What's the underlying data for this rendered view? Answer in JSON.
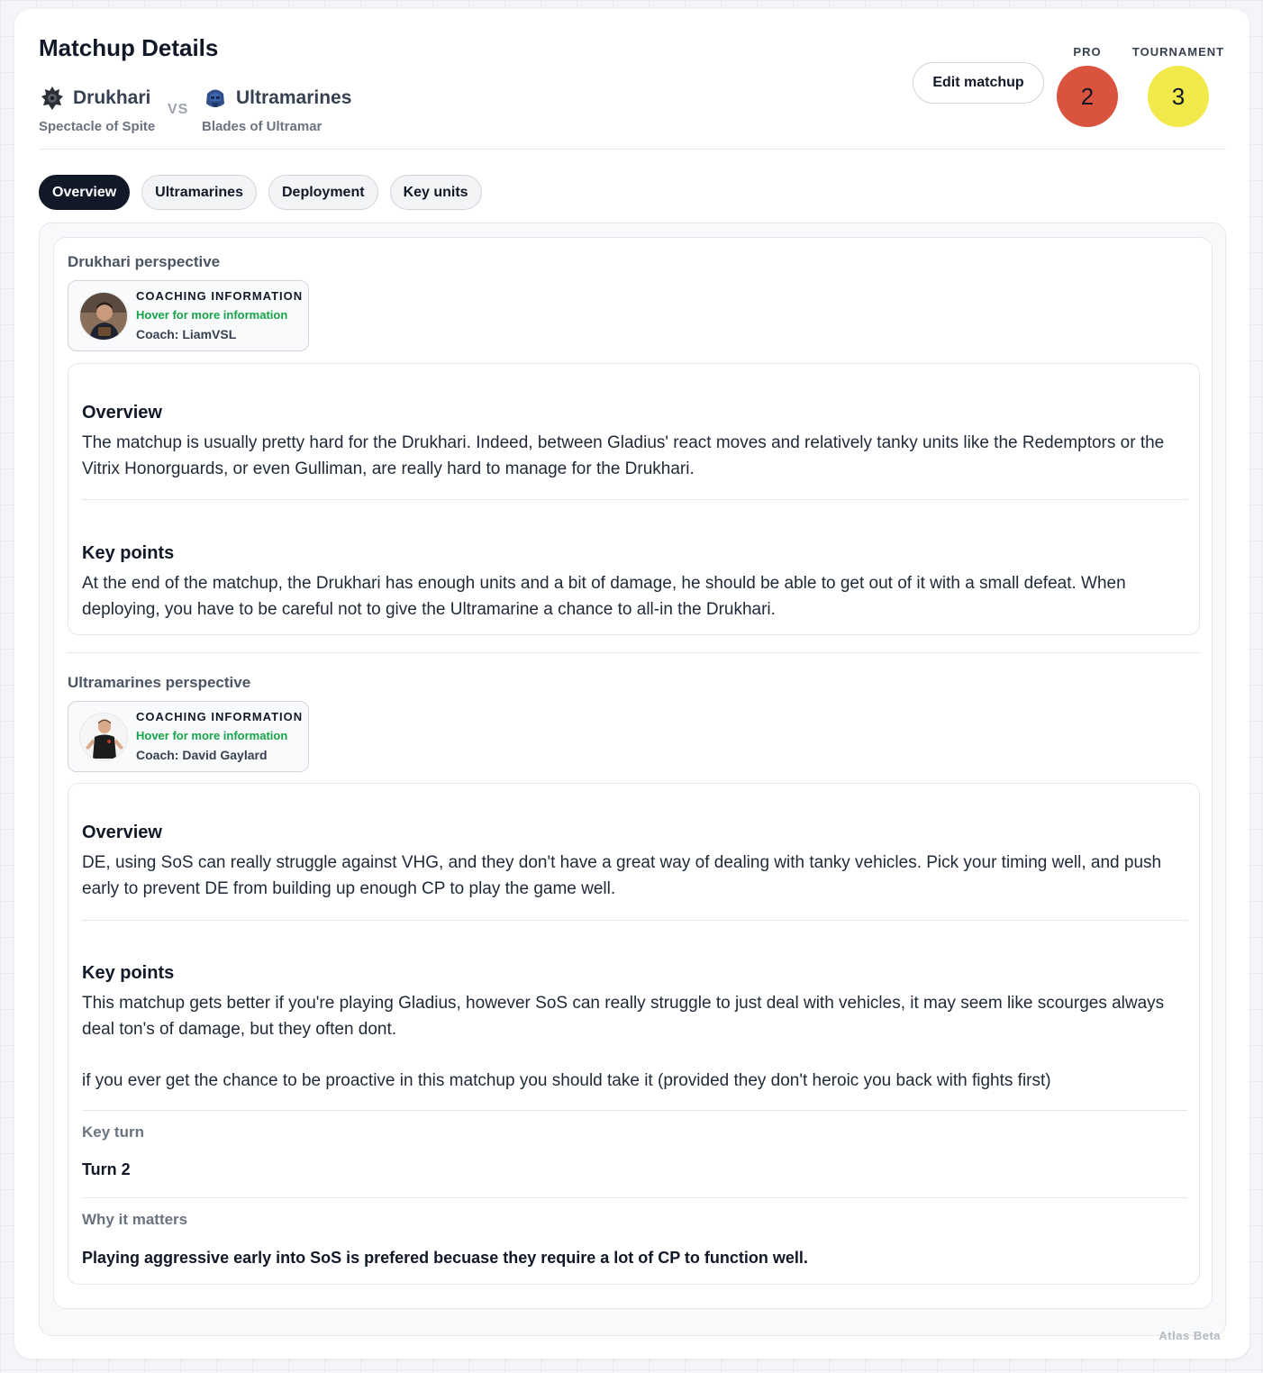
{
  "page": {
    "title": "Matchup Details",
    "watermark": "Atlas Beta"
  },
  "factions": {
    "left": {
      "name": "Drukhari",
      "detachment": "Spectacle of Spite",
      "icon": "drukhari-icon"
    },
    "vs": "VS",
    "right": {
      "name": "Ultramarines",
      "detachment": "Blades of Ultramar",
      "icon": "ultramarines-icon"
    }
  },
  "actions": {
    "edit_label": "Edit matchup"
  },
  "ratings": {
    "pro": {
      "label": "PRO",
      "value": "2",
      "color": "#d9533f"
    },
    "tournament": {
      "label": "TOURNAMENT",
      "value": "3",
      "color": "#f2e94a"
    }
  },
  "tabs": [
    {
      "label": "Overview",
      "active": true
    },
    {
      "label": "Ultramarines",
      "active": false
    },
    {
      "label": "Deployment",
      "active": false
    },
    {
      "label": "Key units",
      "active": false
    }
  ],
  "perspectives": [
    {
      "title": "Drukhari perspective",
      "coach": {
        "heading": "COACHING INFORMATION",
        "hover": "Hover for more information",
        "name": "Coach: LiamVSL"
      },
      "overview_heading": "Overview",
      "overview_text": "The matchup is usually pretty hard for the Drukhari. Indeed, between Gladius' react moves and relatively tanky units like the Redemptors or the Vitrix Honorguards, or even Gulliman, are really hard to manage for the Drukhari.",
      "keypoints_heading": "Key points",
      "keypoints_text": "At the end of the matchup, the Drukhari has enough units and a bit of damage, he should be able to get out of it with a small defeat. When deploying, you have to be careful not to give the Ultramarine a chance to all-in the Drukhari."
    },
    {
      "title": "Ultramarines perspective",
      "coach": {
        "heading": "COACHING INFORMATION",
        "hover": "Hover for more information",
        "name": "Coach: David Gaylard"
      },
      "overview_heading": "Overview",
      "overview_text": "DE, using SoS can really struggle against VHG, and they don't have a great way of dealing with tanky vehicles. Pick your timing well, and push early to prevent DE from building up enough CP to play the game well.",
      "keypoints_heading": "Key points",
      "keypoints_text_1": "This matchup gets better if you're playing Gladius, however SoS can really struggle to just deal with vehicles, it may seem like scourges always deal ton's of damage, but they often dont.",
      "keypoints_text_2": "if you ever get the chance to be proactive in this matchup you should take it (provided they don't heroic you back with fights first)",
      "key_turn_heading": "Key turn",
      "key_turn_value": "Turn 2",
      "why_heading": "Why it matters",
      "why_value": "Playing aggressive early into SoS is prefered becuase they require a lot of CP to function well."
    }
  ]
}
